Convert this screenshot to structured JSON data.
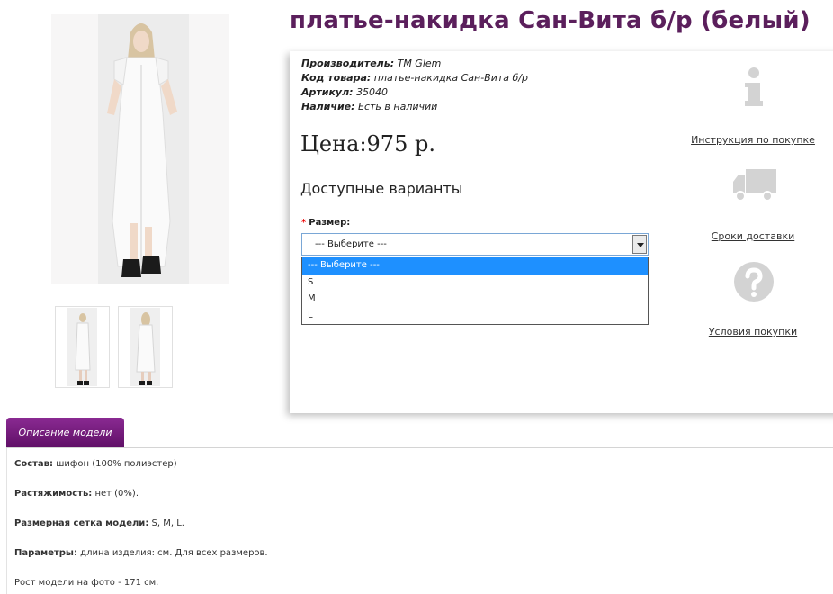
{
  "product": {
    "title": "платье-накидка Сан-Вита б/р (белый)",
    "meta": [
      {
        "label": "Производитель:",
        "value": "TM Glem"
      },
      {
        "label": "Код товара:",
        "value": "платье-накидка Сан-Вита б/р"
      },
      {
        "label": "Артикул:",
        "value": "35040"
      },
      {
        "label": "Наличие:",
        "value": "Есть в наличии"
      }
    ],
    "price": "Цена:975 р.",
    "variants_heading": "Доступные варианты",
    "size_label": "Размер:",
    "size_required_mark": "*"
  },
  "size_select": {
    "selected": "--- Выберите ---",
    "options": [
      "--- Выберите ---",
      "S",
      "M",
      "L"
    ]
  },
  "side_links": {
    "instructions": "Инструкция по покупке",
    "delivery": "Сроки доставки",
    "conditions": "Условия покупки"
  },
  "tabs": {
    "description": "Описание модели"
  },
  "description": [
    {
      "label": "Состав:",
      "value": " шифон (100% полиэстер)"
    },
    {
      "label": "Растяжимость:",
      "value": " нет (0%)."
    },
    {
      "label": "Размерная сетка модели:",
      "value": " S, M, L."
    },
    {
      "label": "Параметры:",
      "value": " длина изделия: см. Для всех размеров."
    },
    {
      "label": "",
      "value": "Рост модели на фото - 171 см."
    }
  ],
  "colors": {
    "title": "#5b1f5c",
    "tab_bg": "#7a1f82",
    "selected_option": "#1e90ff"
  }
}
